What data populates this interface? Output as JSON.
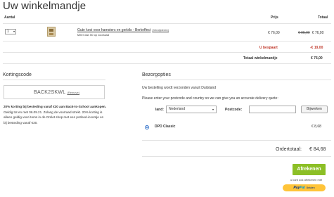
{
  "page": {
    "title": "Uw winkelmandje"
  },
  "cart": {
    "headers": {
      "quantity": "Aantal",
      "price": "Prijs",
      "total": "Totaal"
    },
    "items": [
      {
        "quantity": "1",
        "name": "Gute kooi voor hamsters en gerbils - Berkeffect",
        "variant": "(Verwijderen)",
        "note": "Meer dan 50 op voorraad",
        "price": "€ 76,00",
        "old_total": "€ 95,00",
        "total": "€ 76,00"
      }
    ],
    "saving_label": "U bespaart",
    "saving_value": "-€ 19,00",
    "total_label": "Totaal winkelmandje",
    "total_value": "€ 76,00"
  },
  "coupon": {
    "title": "Kortingscode",
    "code": "BACK2SKWL",
    "remove_label": "(Remove)",
    "desc_bold": "20% korting bij besteding vanaf €30 aan Back-to-School aankopen.",
    "desc_rest": " Geldig tot en met 06.09.21. Zolang de voorraad strekt. 20% korting is alleen geldig voor items in de Omlet shop met een potlood-icoontje en bij besteding vanaf €30."
  },
  "shipping": {
    "title": "Bezorgopties",
    "line1": "Uw bestelling wordt verzonden vanuit Duitsland",
    "line2": "Please enter your postcode and country so we can give you an accurate delivery quote:",
    "land_label": "land:",
    "land_value": "Nederland",
    "postcode_label": "Postcode:",
    "postcode_value": "",
    "update_label": "Bijwerken",
    "options": [
      {
        "label": "DPD Classic",
        "price": "€ 8,68",
        "selected": true
      }
    ]
  },
  "order": {
    "total_label": "Ordertotaal:",
    "total_value": "€ 84,68"
  },
  "checkout": {
    "button_label": "Afrekenen",
    "alt_text": "u kunt ook afrekenen met",
    "paypal_pay": "Pay",
    "paypal_pal": "Pal",
    "paypal_tag": "Betalen"
  },
  "colors": {
    "accent_green": "#8cbf26",
    "saving_red": "#c0392b",
    "paypal_yellow": "#ffc439",
    "radio_blue": "#2e6fc9"
  }
}
